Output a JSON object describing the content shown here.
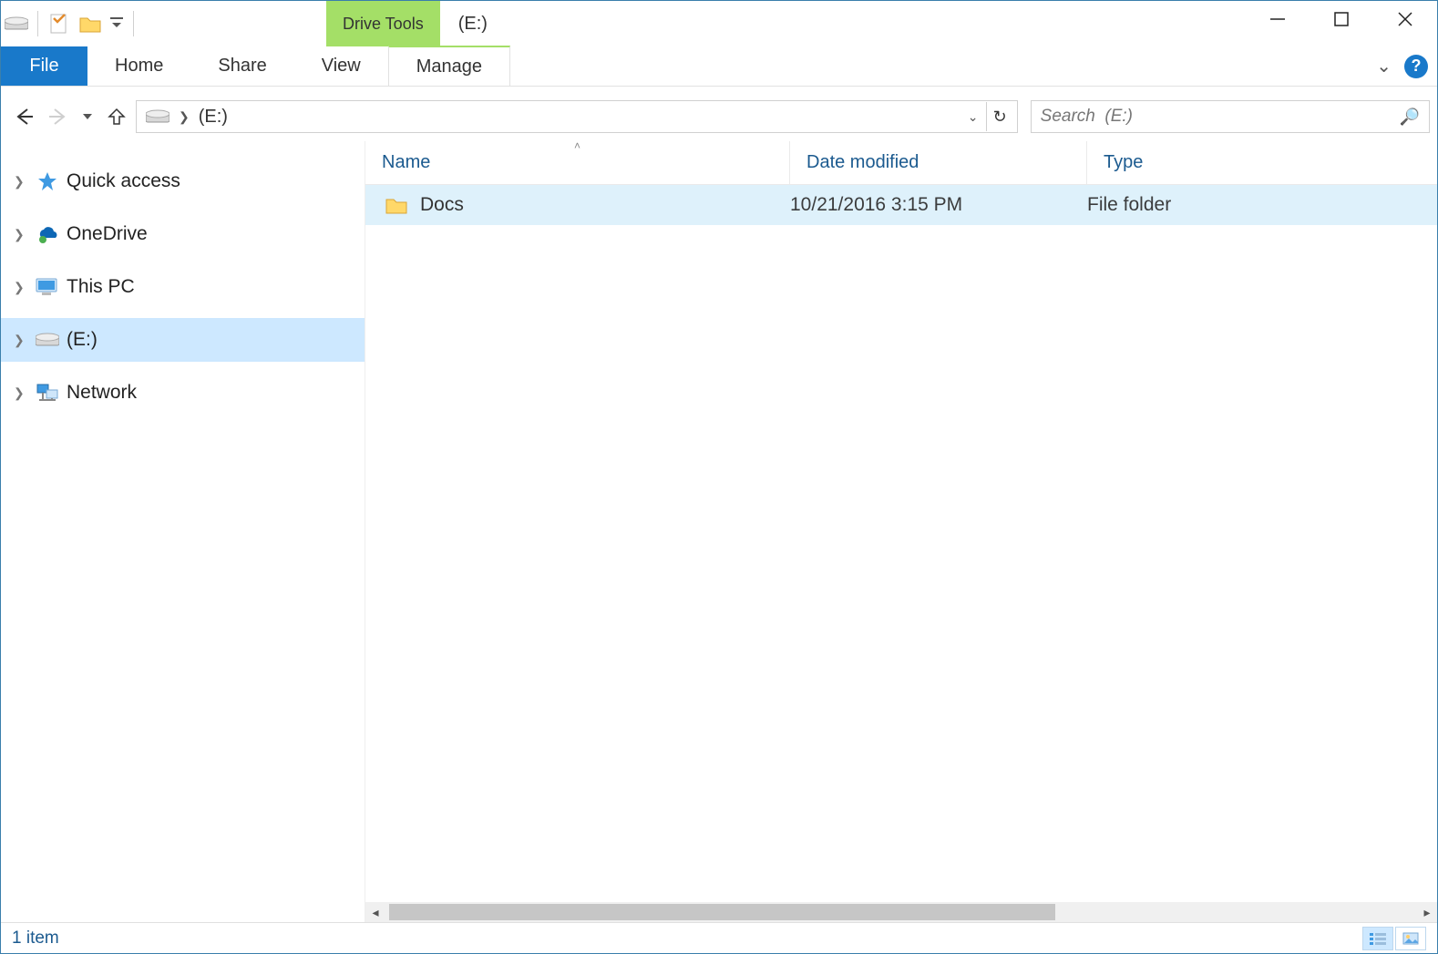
{
  "window": {
    "title": "(E:)",
    "ribbon_context_label": "Drive Tools"
  },
  "ribbon": {
    "file": "File",
    "tabs": [
      "Home",
      "Share",
      "View"
    ],
    "context_tab": "Manage"
  },
  "address": {
    "location_label": "(E:)"
  },
  "search": {
    "placeholder": "Search  (E:)"
  },
  "navpane": {
    "items": [
      {
        "label": "Quick access",
        "icon": "star"
      },
      {
        "label": "OneDrive",
        "icon": "cloud"
      },
      {
        "label": "This PC",
        "icon": "pc"
      },
      {
        "label": "(E:)",
        "icon": "drive",
        "selected": true
      },
      {
        "label": "Network",
        "icon": "network"
      }
    ]
  },
  "columns": {
    "name": "Name",
    "date": "Date modified",
    "type": "Type"
  },
  "rows": [
    {
      "name": "Docs",
      "date": "10/21/2016 3:15 PM",
      "type": "File folder"
    }
  ],
  "status": {
    "text": "1 item"
  }
}
